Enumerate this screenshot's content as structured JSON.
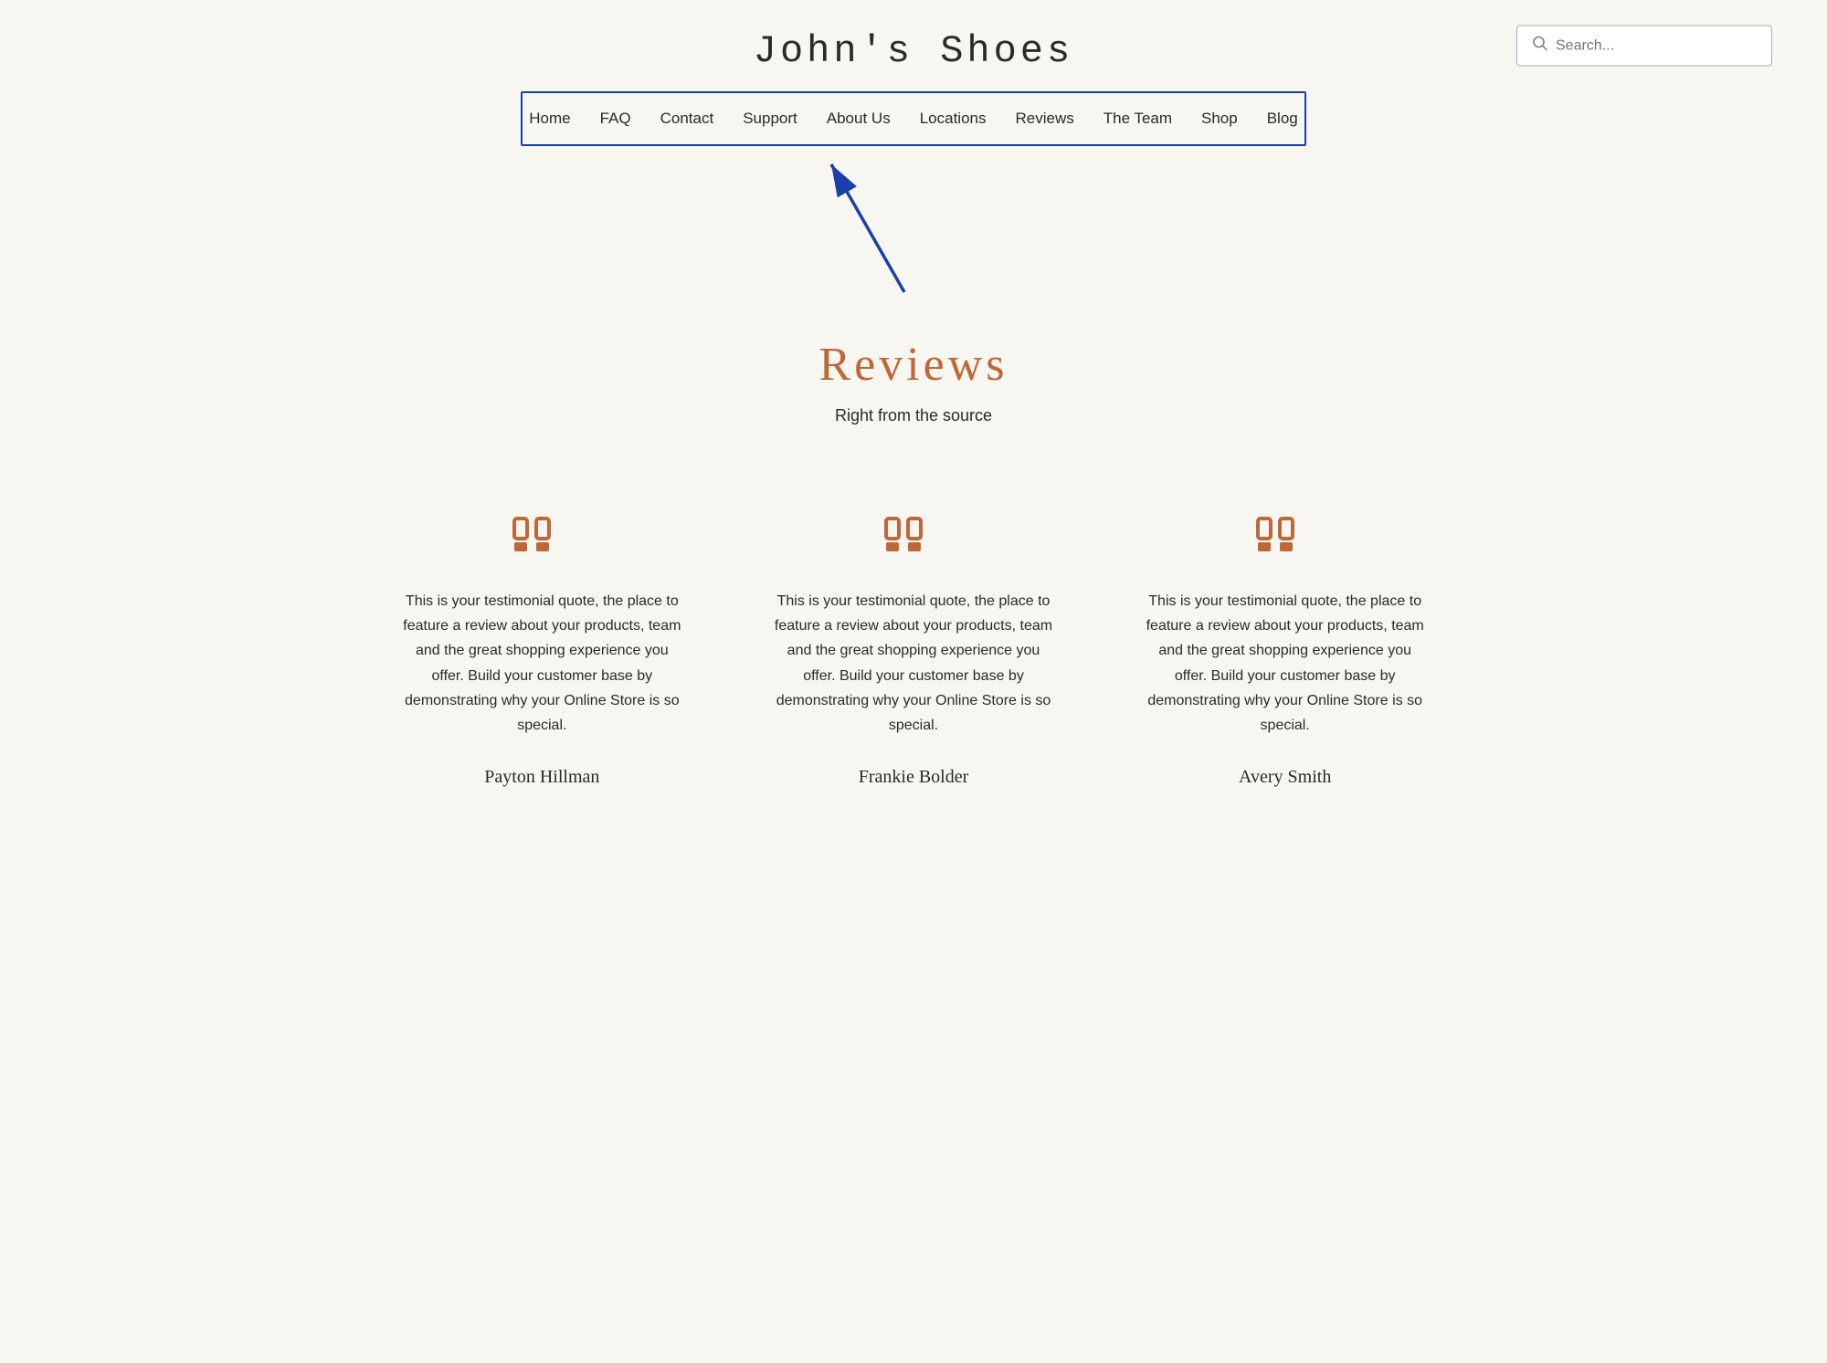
{
  "header": {
    "site_title": "John's Shoes",
    "search_placeholder": "Search..."
  },
  "nav": {
    "items": [
      {
        "label": "Home",
        "id": "nav-home"
      },
      {
        "label": "FAQ",
        "id": "nav-faq"
      },
      {
        "label": "Contact",
        "id": "nav-contact"
      },
      {
        "label": "Support",
        "id": "nav-support"
      },
      {
        "label": "About Us",
        "id": "nav-about"
      },
      {
        "label": "Locations",
        "id": "nav-locations"
      },
      {
        "label": "Reviews",
        "id": "nav-reviews"
      },
      {
        "label": "The Team",
        "id": "nav-team"
      },
      {
        "label": "Shop",
        "id": "nav-shop"
      },
      {
        "label": "Blog",
        "id": "nav-blog"
      }
    ]
  },
  "reviews_section": {
    "title": "Reviews",
    "subtitle": "Right from the source"
  },
  "testimonials": [
    {
      "quote": "This is your testimonial quote, the place to feature a review about your products, team and the great shopping experience you offer. Build your customer base by demonstrating why your Online Store is so special.",
      "author": "Payton Hillman"
    },
    {
      "quote": "This is your testimonial quote, the place to feature a review about your products, team and the great shopping experience you offer. Build your customer base by demonstrating why your Online Store is so special.",
      "author": "Frankie Bolder"
    },
    {
      "quote": "This is your testimonial quote, the place to feature a review about your products, team and the great shopping experience you offer. Build your customer base by demonstrating why your Online Store is so special.",
      "author": "Avery Smith"
    }
  ],
  "colors": {
    "accent": "#c0673a",
    "nav_border": "#1a3faa",
    "arrow": "#1a3faa"
  }
}
